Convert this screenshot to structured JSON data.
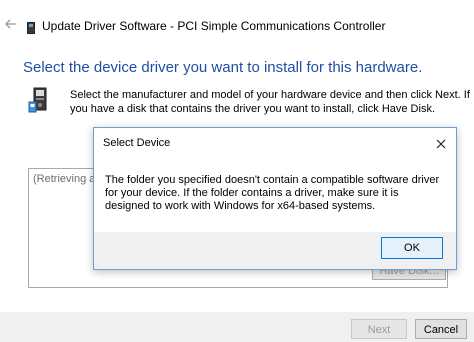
{
  "window": {
    "title": "Update Driver Software - PCI Simple Communications Controller",
    "heading": "Select the device driver you want to install for this hardware.",
    "description": "Select the manufacturer and model of your hardware device and then click Next. If you have a disk that contains the driver you want to install, click Have Disk.",
    "list_placeholder": "(Retrieving a lis",
    "have_disk_label": "Have Disk...",
    "next_label": "Next",
    "cancel_label": "Cancel"
  },
  "dialog": {
    "title": "Select Device",
    "message": "The folder you specified doesn't contain a compatible software driver for your device. If the folder contains a driver, make sure it is designed to work with Windows for x64-based systems.",
    "ok_label": "OK"
  },
  "icons": {
    "back": "back-arrow-icon",
    "device": "device-icon",
    "wizard": "hardware-wizard-icon",
    "close": "close-icon"
  },
  "colors": {
    "heading": "#1f4fa3",
    "dialog_border": "#6d9fd6",
    "ok_border": "#0078d7"
  }
}
